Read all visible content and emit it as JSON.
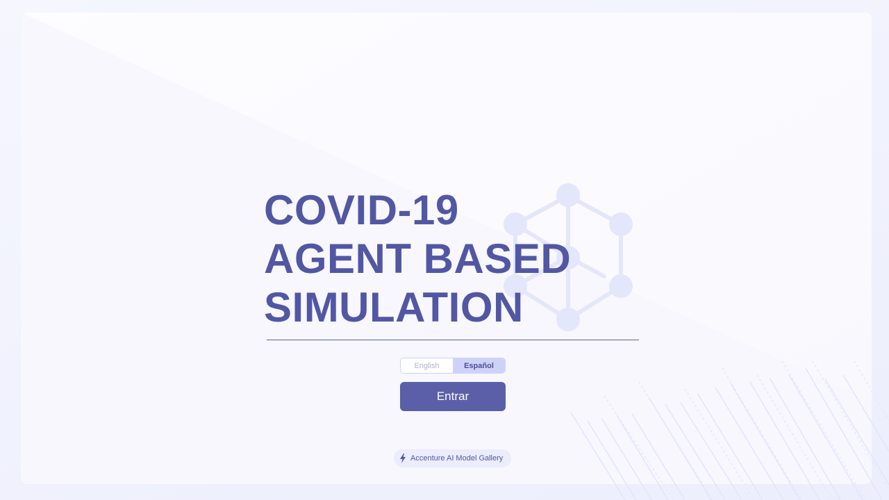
{
  "title": {
    "line1": "COVID-19",
    "line2": "AGENT BASED",
    "line3": "SIMULATION"
  },
  "language_toggle": {
    "options": [
      {
        "label": "English",
        "active": false
      },
      {
        "label": "Español",
        "active": true
      }
    ]
  },
  "enter_button": {
    "label": "Entrar"
  },
  "footer_link": {
    "label": "Accenture AI Model Gallery",
    "icon": "bolt-icon"
  },
  "colors": {
    "primary": "#5a5fa8",
    "title": "#5257a3",
    "toggle_active_bg": "#cfd2f8",
    "icon_tint": "#e4e6fb",
    "page_bg": "#eceefc"
  }
}
